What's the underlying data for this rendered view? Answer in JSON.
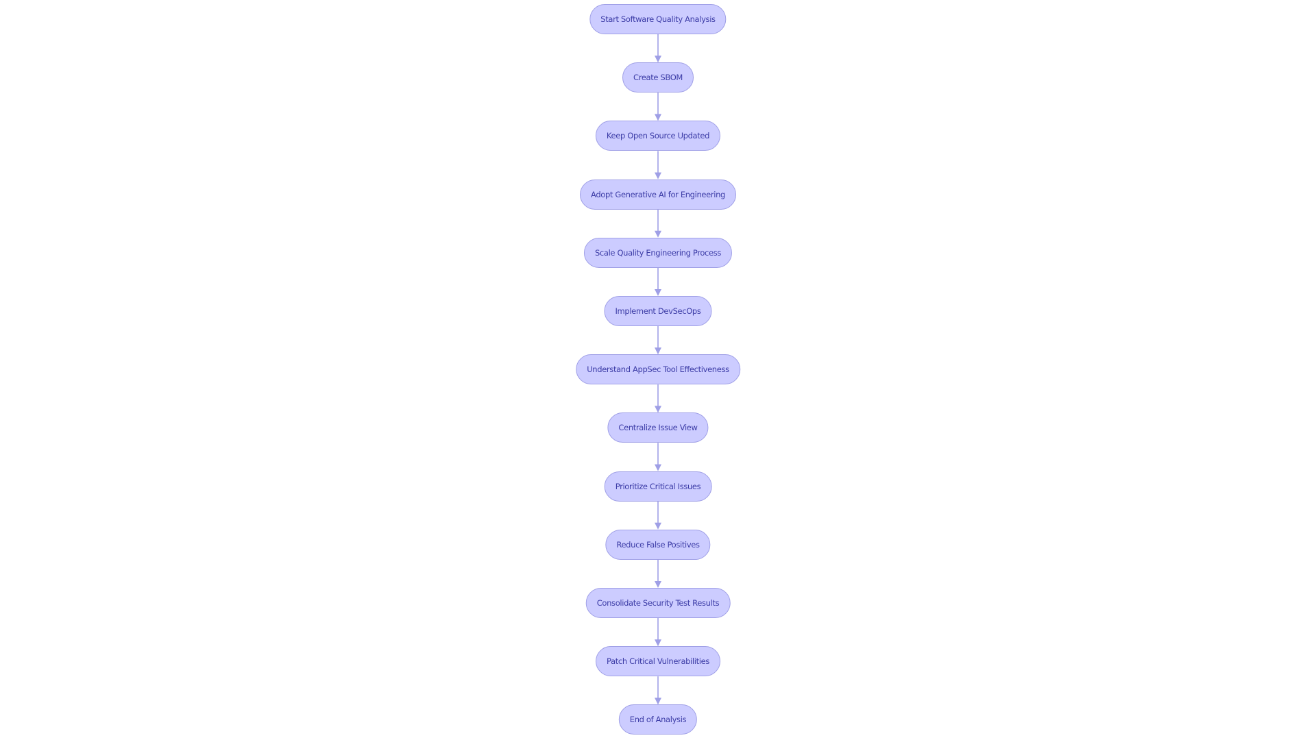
{
  "diagram": {
    "type": "flowchart",
    "direction": "top-to-bottom",
    "colors": {
      "node_fill": "#ccccff",
      "node_border": "#9f9fe6",
      "node_text": "#3b3ba6",
      "edge": "#9f9fe6",
      "background": "#ffffff"
    },
    "nodes": [
      {
        "id": "start",
        "label": "Start Software Quality Analysis"
      },
      {
        "id": "sbom",
        "label": "Create SBOM"
      },
      {
        "id": "oss",
        "label": "Keep Open Source Updated"
      },
      {
        "id": "genai",
        "label": "Adopt Generative AI for Engineering"
      },
      {
        "id": "scale",
        "label": "Scale Quality Engineering Process"
      },
      {
        "id": "devsecops",
        "label": "Implement DevSecOps"
      },
      {
        "id": "appsec",
        "label": "Understand AppSec Tool Effectiveness"
      },
      {
        "id": "centralize",
        "label": "Centralize Issue View"
      },
      {
        "id": "prioritize",
        "label": "Prioritize Critical Issues"
      },
      {
        "id": "falsepos",
        "label": "Reduce False Positives"
      },
      {
        "id": "consolidate",
        "label": "Consolidate Security Test Results"
      },
      {
        "id": "patch",
        "label": "Patch Critical Vulnerabilities"
      },
      {
        "id": "end",
        "label": "End of Analysis"
      }
    ],
    "edges": [
      {
        "from": "start",
        "to": "sbom"
      },
      {
        "from": "sbom",
        "to": "oss"
      },
      {
        "from": "oss",
        "to": "genai"
      },
      {
        "from": "genai",
        "to": "scale"
      },
      {
        "from": "scale",
        "to": "devsecops"
      },
      {
        "from": "devsecops",
        "to": "appsec"
      },
      {
        "from": "appsec",
        "to": "centralize"
      },
      {
        "from": "centralize",
        "to": "prioritize"
      },
      {
        "from": "prioritize",
        "to": "falsepos"
      },
      {
        "from": "falsepos",
        "to": "consolidate"
      },
      {
        "from": "consolidate",
        "to": "patch"
      },
      {
        "from": "patch",
        "to": "end"
      }
    ]
  }
}
